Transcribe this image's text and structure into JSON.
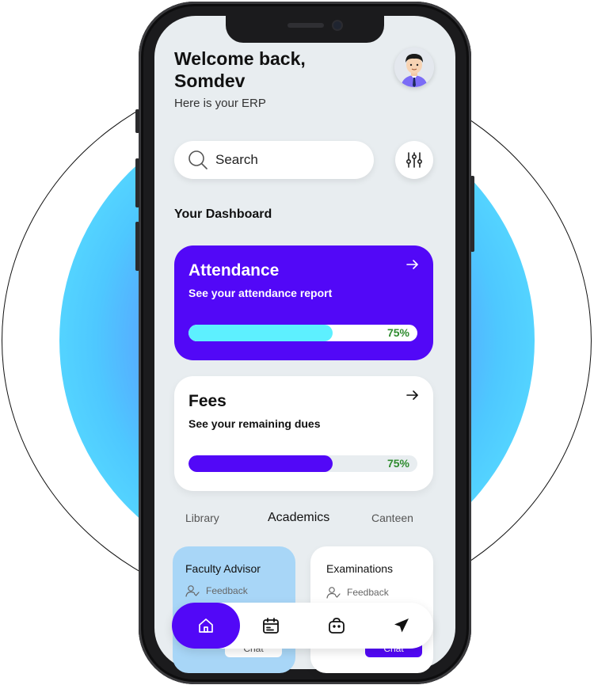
{
  "header": {
    "welcome": "Welcome back, Somdev",
    "subtitle": "Here is your ERP"
  },
  "search": {
    "placeholder": "Search"
  },
  "dashboard": {
    "title": "Your Dashboard"
  },
  "cards": {
    "attendance": {
      "title": "Attendance",
      "subtitle": "See your attendance report",
      "percent_label": "75%",
      "progress": 0.63
    },
    "fees": {
      "title": "Fees",
      "subtitle": "See your remaining dues",
      "percent_label": "75%",
      "progress": 0.63
    }
  },
  "tabs": [
    {
      "label": "Library"
    },
    {
      "label": "Academics"
    },
    {
      "label": "Canteen"
    }
  ],
  "mini_cards": [
    {
      "title": "Faculty Advisor",
      "feedback": "Feedback",
      "chat": "Chat"
    },
    {
      "title": "Examinations",
      "feedback": "Feedback",
      "chat": "Chat"
    }
  ],
  "colors": {
    "accent": "#5208f7",
    "attendance_bar": "#5df0ff",
    "percent_text": "#2e8b2e",
    "faculty_card": "#a8d6f7",
    "screen_bg": "#e8edf0"
  },
  "icons": {
    "search": "search-icon",
    "filter": "sliders-icon",
    "arrow": "arrow-right-icon",
    "feedback": "user-check-icon",
    "nav": [
      "home-icon",
      "calendar-icon",
      "bag-icon",
      "send-icon"
    ]
  }
}
